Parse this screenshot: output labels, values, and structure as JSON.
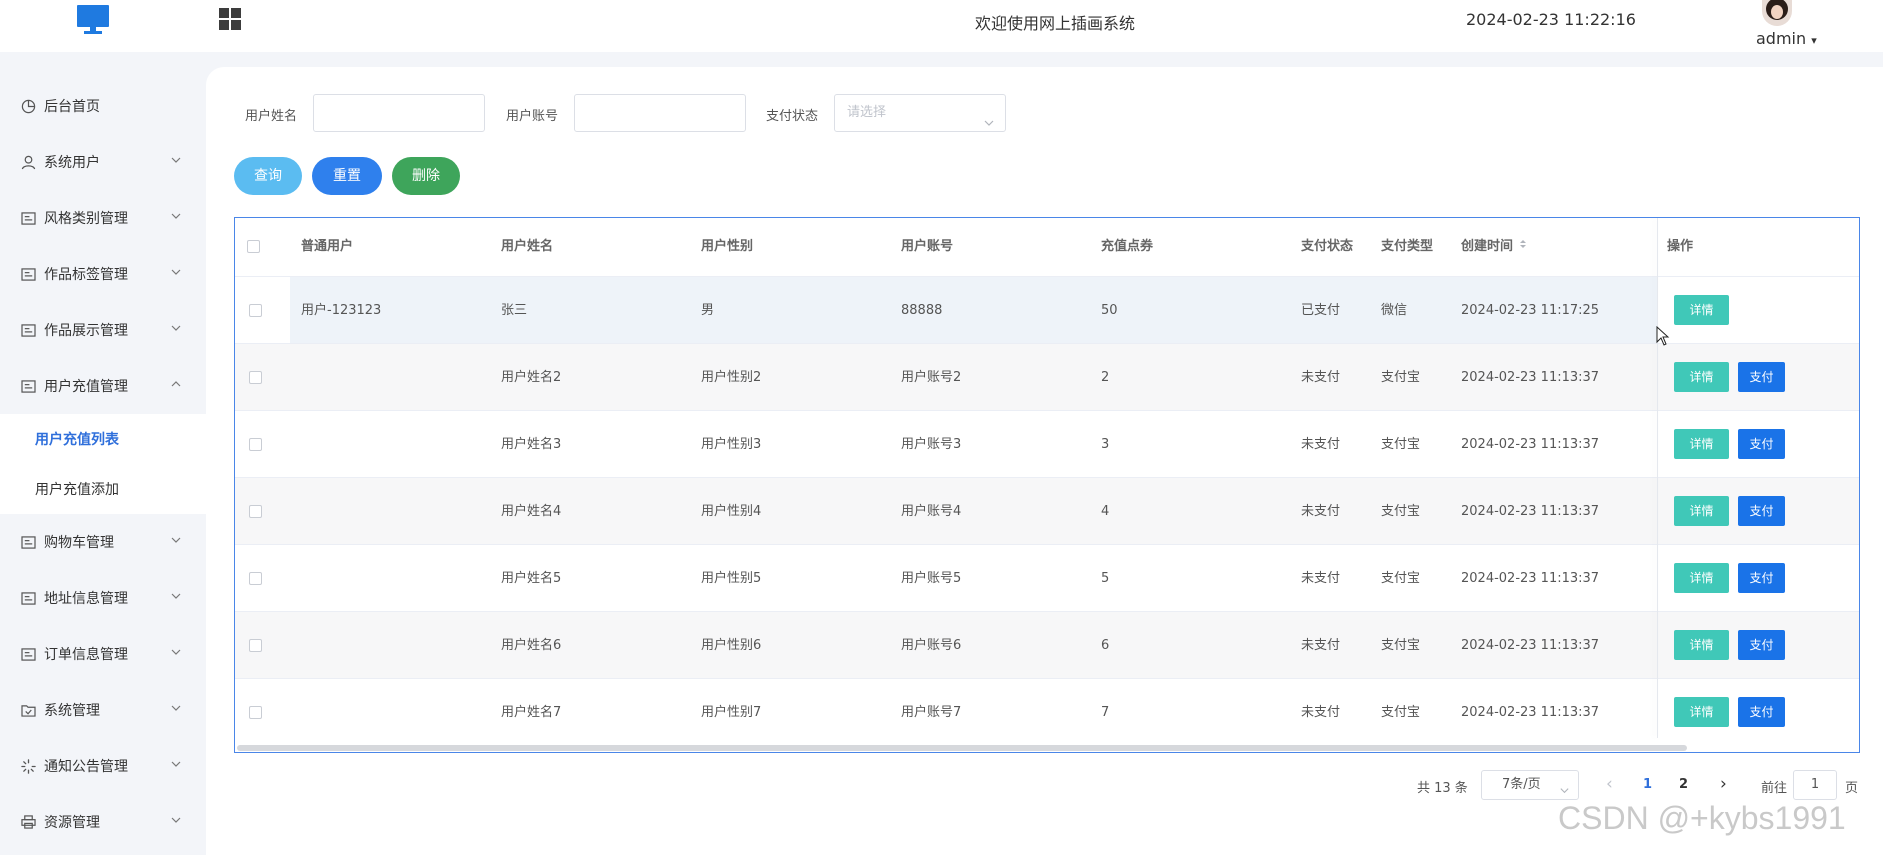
{
  "header": {
    "title": "欢迎使用网上插画系统",
    "datetime": "2024-02-23 11:22:16",
    "user": "admin",
    "caret": "▾"
  },
  "sidebar": {
    "items": [
      {
        "label": "后台首页",
        "icon": "pie-chart-icon",
        "has_chevron": false
      },
      {
        "label": "系统用户",
        "icon": "user-icon",
        "has_chevron": true
      },
      {
        "label": "风格类别管理",
        "icon": "form-icon",
        "has_chevron": true
      },
      {
        "label": "作品标签管理",
        "icon": "form-icon",
        "has_chevron": true
      },
      {
        "label": "作品展示管理",
        "icon": "form-icon",
        "has_chevron": true
      },
      {
        "label": "用户充值管理",
        "icon": "form-icon",
        "has_chevron": true,
        "expanded": true
      },
      {
        "label": "购物车管理",
        "icon": "form-icon",
        "has_chevron": true
      },
      {
        "label": "地址信息管理",
        "icon": "form-icon",
        "has_chevron": true
      },
      {
        "label": "订单信息管理",
        "icon": "form-icon",
        "has_chevron": true
      },
      {
        "label": "系统管理",
        "icon": "folder-check-icon",
        "has_chevron": true
      },
      {
        "label": "通知公告管理",
        "icon": "loading-icon",
        "has_chevron": true
      },
      {
        "label": "资源管理",
        "icon": "printer-icon",
        "has_chevron": true
      }
    ],
    "subitems": [
      {
        "label": "用户充值列表",
        "active": true
      },
      {
        "label": "用户充值添加",
        "active": false
      }
    ]
  },
  "filters": {
    "name_label": "用户姓名",
    "name_value": "",
    "account_label": "用户账号",
    "account_value": "",
    "pay_label": "支付状态",
    "pay_placeholder": "请选择"
  },
  "actions": {
    "query": "查询",
    "reset": "重置",
    "delete": "删除"
  },
  "table": {
    "headers": [
      "普通用户",
      "用户姓名",
      "用户性别",
      "用户账号",
      "充值点券",
      "支付状态",
      "支付类型",
      "创建时间",
      "操作"
    ],
    "rows": [
      {
        "user": "用户-123123",
        "name": "张三",
        "gender": "男",
        "account": "88888",
        "points": "50",
        "status": "已支付",
        "type": "微信",
        "created": "2024-02-23 11:17:25",
        "detail": "详情",
        "pay": ""
      },
      {
        "user": "",
        "name": "用户姓名2",
        "gender": "用户性别2",
        "account": "用户账号2",
        "points": "2",
        "status": "未支付",
        "type": "支付宝",
        "created": "2024-02-23 11:13:37",
        "detail": "详情",
        "pay": "支付"
      },
      {
        "user": "",
        "name": "用户姓名3",
        "gender": "用户性别3",
        "account": "用户账号3",
        "points": "3",
        "status": "未支付",
        "type": "支付宝",
        "created": "2024-02-23 11:13:37",
        "detail": "详情",
        "pay": "支付"
      },
      {
        "user": "",
        "name": "用户姓名4",
        "gender": "用户性别4",
        "account": "用户账号4",
        "points": "4",
        "status": "未支付",
        "type": "支付宝",
        "created": "2024-02-23 11:13:37",
        "detail": "详情",
        "pay": "支付"
      },
      {
        "user": "",
        "name": "用户姓名5",
        "gender": "用户性别5",
        "account": "用户账号5",
        "points": "5",
        "status": "未支付",
        "type": "支付宝",
        "created": "2024-02-23 11:13:37",
        "detail": "详情",
        "pay": "支付"
      },
      {
        "user": "",
        "name": "用户姓名6",
        "gender": "用户性别6",
        "account": "用户账号6",
        "points": "6",
        "status": "未支付",
        "type": "支付宝",
        "created": "2024-02-23 11:13:37",
        "detail": "详情",
        "pay": "支付"
      },
      {
        "user": "",
        "name": "用户姓名7",
        "gender": "用户性别7",
        "account": "用户账号7",
        "points": "7",
        "status": "未支付",
        "type": "支付宝",
        "created": "2024-02-23 11:13:37",
        "detail": "详情",
        "pay": "支付"
      }
    ]
  },
  "pagination": {
    "total": "共 13 条",
    "page_size": "7条/页",
    "prev": "‹",
    "pages": [
      "1",
      "2"
    ],
    "current": "1",
    "next": "›",
    "goto_label": "前往",
    "goto_value": "1",
    "page_suffix": "页"
  },
  "watermark": "CSDN @+kybs1991",
  "colors": {
    "accent": "#2f6fdb",
    "query": "#5bbcf1",
    "reset": "#2f80ed",
    "delete": "#3ea55b",
    "detail": "#40c8b8",
    "pay": "#1a73e8"
  }
}
